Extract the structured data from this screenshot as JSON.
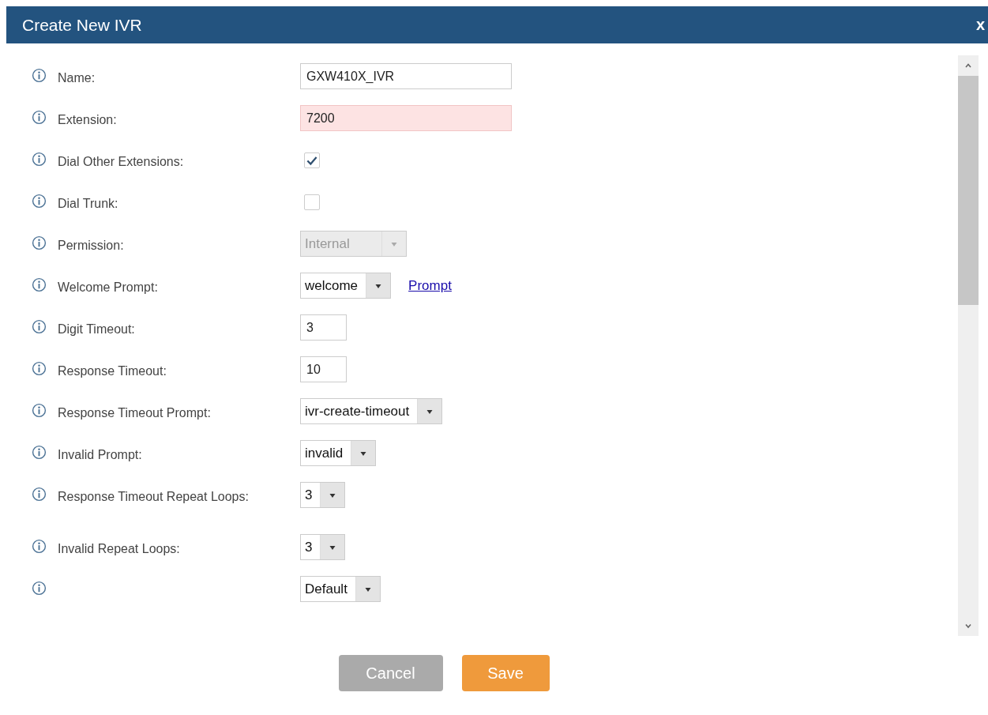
{
  "dialog": {
    "title": "Create New IVR",
    "close": "x"
  },
  "fields": [
    {
      "kind": "text",
      "label": "Name:",
      "value": "GXW410X_IVR",
      "invalid": false
    },
    {
      "kind": "text",
      "label": "Extension:",
      "value": "7200",
      "invalid": true
    },
    {
      "kind": "checkbox",
      "label": "Dial Other Extensions:",
      "checked": true
    },
    {
      "kind": "checkbox",
      "label": "Dial Trunk:",
      "checked": false
    },
    {
      "kind": "select",
      "label": "Permission:",
      "value": "Internal",
      "disabled": true
    },
    {
      "kind": "select",
      "label": "Welcome Prompt:",
      "value": "welcome",
      "disabled": false,
      "link": "Prompt"
    },
    {
      "kind": "number",
      "label": "Digit Timeout:",
      "value": "3",
      "invalid": false
    },
    {
      "kind": "number",
      "label": "Response Timeout:",
      "value": "10",
      "invalid": false
    },
    {
      "kind": "select",
      "label": "Response Timeout Prompt:",
      "value": "ivr-create-timeout",
      "disabled": false
    },
    {
      "kind": "select",
      "label": "Invalid Prompt:",
      "value": "invalid",
      "disabled": false
    },
    {
      "kind": "select",
      "label": "Response Timeout Repeat Loops:",
      "value": "3",
      "disabled": false
    },
    {
      "kind": "select",
      "label": "Invalid Repeat Loops:",
      "value": "3",
      "disabled": false
    },
    {
      "kind": "select",
      "value": "Default",
      "disabled": false
    }
  ],
  "buttons": [
    {
      "kind": "cancel",
      "label": "Cancel"
    },
    {
      "kind": "save",
      "label": "Save"
    }
  ]
}
